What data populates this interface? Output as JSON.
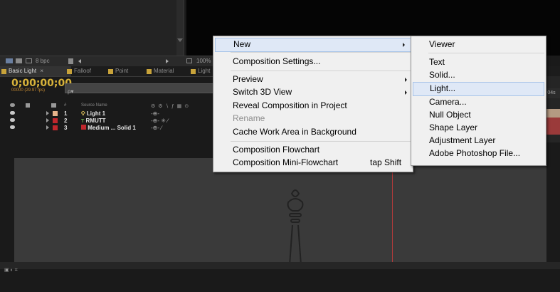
{
  "project": {
    "bpc_label": "8 bpc"
  },
  "viewer": {
    "zoom_label": "100%"
  },
  "tabs": [
    {
      "label": "Basic Light",
      "close": "×",
      "active": true
    },
    {
      "label": "Falloof"
    },
    {
      "label": "Point"
    },
    {
      "label": "Material"
    },
    {
      "label": "Light"
    }
  ],
  "timeline": {
    "timecode": "0;00;00;00",
    "fps": "00000 (29.97 fps)",
    "search_placeholder": "ρ▾",
    "columns": {
      "number": "#",
      "source_name": "Source Name"
    },
    "layers": [
      {
        "num": "1",
        "name": "Light 1",
        "label_color": "#e6b48c",
        "name_color": "#f0f0f0"
      },
      {
        "num": "2",
        "name": "RMUTT",
        "label_color": "#c0272d",
        "name_color": "#f0f0f0"
      },
      {
        "num": "3",
        "name": "Medium ... Solid 1",
        "label_color": "#c0272d",
        "name_color": "#f0f0f0"
      }
    ],
    "ruler_label": "04s"
  },
  "context_menu": {
    "items": [
      {
        "label": "New",
        "submenu": true
      },
      {
        "label": "Composition Settings..."
      },
      {
        "label": "Preview",
        "submenu": true
      },
      {
        "label": "Switch 3D View",
        "submenu": true
      },
      {
        "label": "Reveal Composition in Project"
      },
      {
        "label": "Rename",
        "disabled": true
      },
      {
        "label": "Cache Work Area in Background"
      },
      {
        "label": "Composition Flowchart"
      },
      {
        "label": "Composition Mini-Flowchart",
        "shortcut": "tap Shift"
      }
    ]
  },
  "submenu_new": {
    "items": [
      {
        "label": "Viewer"
      },
      {
        "label": "Text"
      },
      {
        "label": "Solid..."
      },
      {
        "label": "Light...",
        "highlighted": true
      },
      {
        "label": "Camera..."
      },
      {
        "label": "Null Object"
      },
      {
        "label": "Shape Layer"
      },
      {
        "label": "Adjustment Layer"
      },
      {
        "label": "Adobe Photoshop File..."
      }
    ]
  },
  "colors": {
    "timecode": "#d8b33a",
    "menu_bg": "#f0f0f0",
    "menu_highlight": "#dfe8f6",
    "panel_bg": "#232323"
  }
}
